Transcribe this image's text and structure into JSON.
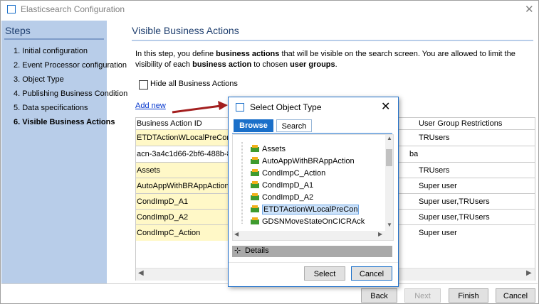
{
  "window": {
    "title": "Elasticsearch Configuration",
    "close_glyph": "✕"
  },
  "steps": {
    "title": "Steps",
    "items": [
      "1. Initial configuration",
      "2. Event Processor configuration",
      "3. Object Type",
      "4. Publishing Business Condition",
      "5. Data specifications",
      "6. Visible Business Actions"
    ]
  },
  "main": {
    "title": "Visible Business Actions",
    "desc_p1": "In this step, you define ",
    "desc_b1": "business actions",
    "desc_p2": " that will be visible on the search screen. You are allowed to limit the visibility of each ",
    "desc_b2": "business action",
    "desc_p3": " to chosen ",
    "desc_b3": "user groups",
    "desc_p4": ".",
    "hide_label": "Hide all Business Actions",
    "add_new": "Add new"
  },
  "table": {
    "col1": "Business Action ID",
    "col3": "User Group Restrictions",
    "rows": [
      {
        "id": "ETDTActionWLocalPreCon",
        "groups": "TRUsers"
      },
      {
        "id": "acn-3a4c1d66-2bf6-488b-8",
        "mid": "bal",
        "groups": ""
      },
      {
        "id": "Assets",
        "groups": "TRUsers"
      },
      {
        "id": "AutoAppWithBRAppAction",
        "groups": "Super user"
      },
      {
        "id": "CondImpD_A1",
        "groups": "Super user,TRUsers"
      },
      {
        "id": "CondImpD_A2",
        "groups": "Super user,TRUsers"
      },
      {
        "id": "CondImpC_Action",
        "groups": "Super user"
      }
    ]
  },
  "buttons": {
    "back": "Back",
    "next": "Next",
    "finish": "Finish",
    "cancel": "Cancel"
  },
  "dialog": {
    "title": "Select Object Type",
    "tab_browse": "Browse",
    "tab_search": "Search",
    "items": [
      "Assets",
      "AutoAppWithBRAppAction",
      "CondImpC_Action",
      "CondImpD_A1",
      "CondImpD_A2",
      "ETDTActionWLocalPreCon",
      "GDSNMoveStateOnCICRAck"
    ],
    "selected_index": 5,
    "details_label": "Details",
    "select": "Select",
    "cancel": "Cancel"
  },
  "colors": {
    "accent": "#1a6fc9",
    "steps_bg": "#b8cde9",
    "row_highlight": "#fff8c7",
    "arrow": "#a31f1f"
  },
  "icons": {
    "tree_item": "object-type-icon",
    "details": "key-icon"
  }
}
